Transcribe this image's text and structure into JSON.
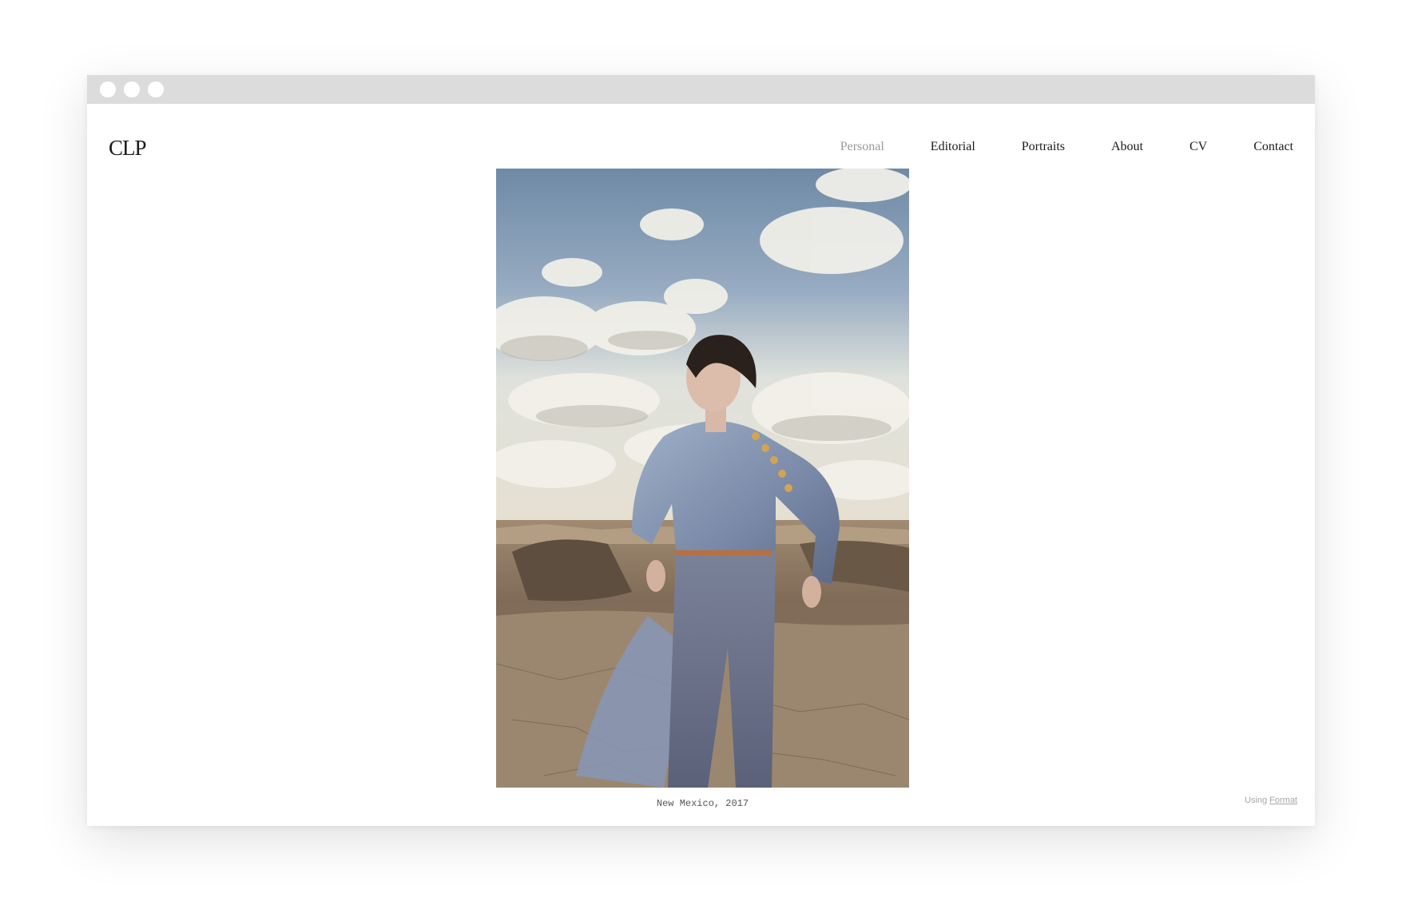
{
  "site": {
    "logo": "CLP",
    "nav": [
      {
        "label": "Personal",
        "active": true
      },
      {
        "label": "Editorial",
        "active": false
      },
      {
        "label": "Portraits",
        "active": false
      },
      {
        "label": "About",
        "active": false
      },
      {
        "label": "CV",
        "active": false
      },
      {
        "label": "Contact",
        "active": false
      }
    ],
    "nav_active_color": "#9a9a9a",
    "text_color": "#1a1a1a"
  },
  "gallery": {
    "caption": "New Mexico, 2017"
  },
  "footer": {
    "prefix": "Using",
    "link": "Format"
  },
  "browser": {
    "titlebar_color": "#dcdcdc"
  }
}
